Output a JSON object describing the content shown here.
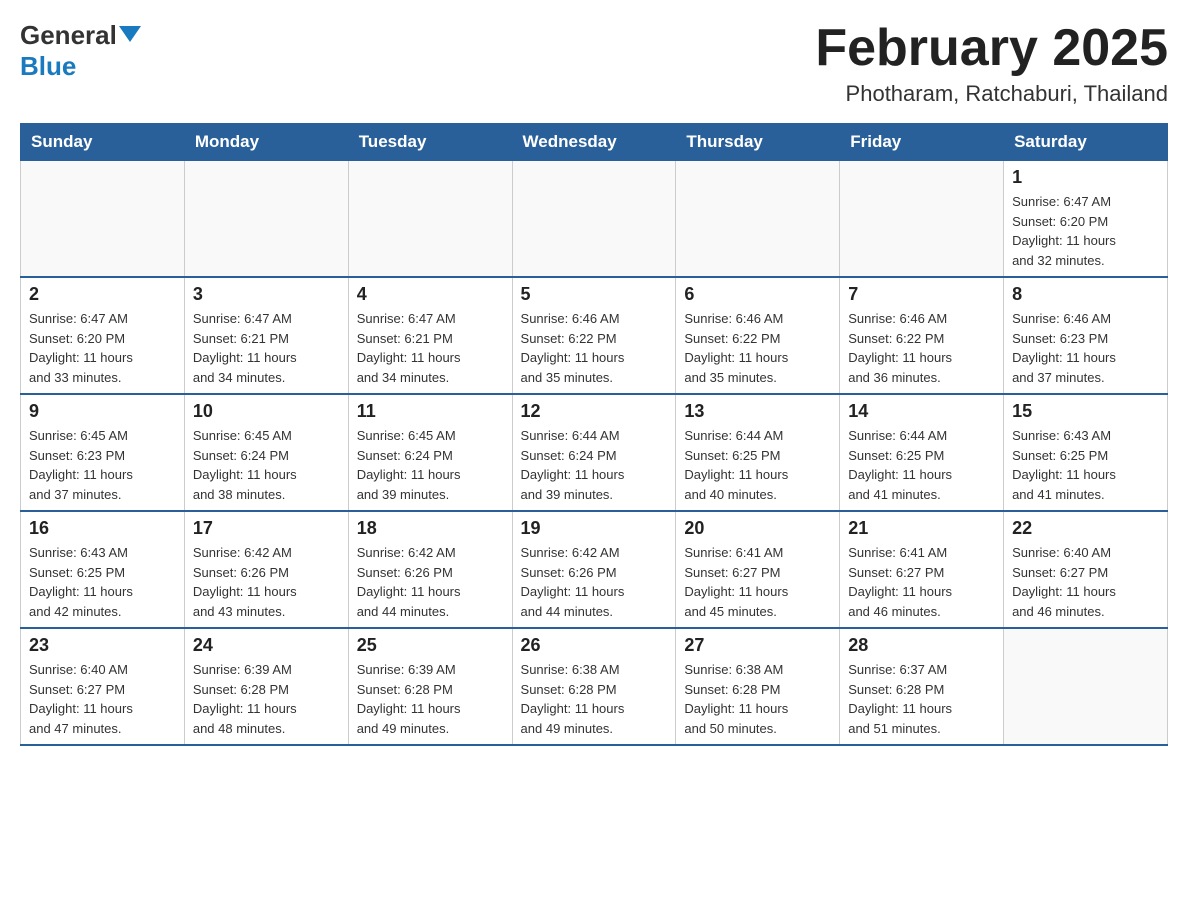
{
  "header": {
    "logo_general": "General",
    "logo_blue": "Blue",
    "title": "February 2025",
    "subtitle": "Photharam, Ratchaburi, Thailand"
  },
  "weekdays": [
    "Sunday",
    "Monday",
    "Tuesday",
    "Wednesday",
    "Thursday",
    "Friday",
    "Saturday"
  ],
  "weeks": [
    [
      {
        "day": "",
        "info": ""
      },
      {
        "day": "",
        "info": ""
      },
      {
        "day": "",
        "info": ""
      },
      {
        "day": "",
        "info": ""
      },
      {
        "day": "",
        "info": ""
      },
      {
        "day": "",
        "info": ""
      },
      {
        "day": "1",
        "info": "Sunrise: 6:47 AM\nSunset: 6:20 PM\nDaylight: 11 hours\nand 32 minutes."
      }
    ],
    [
      {
        "day": "2",
        "info": "Sunrise: 6:47 AM\nSunset: 6:20 PM\nDaylight: 11 hours\nand 33 minutes."
      },
      {
        "day": "3",
        "info": "Sunrise: 6:47 AM\nSunset: 6:21 PM\nDaylight: 11 hours\nand 34 minutes."
      },
      {
        "day": "4",
        "info": "Sunrise: 6:47 AM\nSunset: 6:21 PM\nDaylight: 11 hours\nand 34 minutes."
      },
      {
        "day": "5",
        "info": "Sunrise: 6:46 AM\nSunset: 6:22 PM\nDaylight: 11 hours\nand 35 minutes."
      },
      {
        "day": "6",
        "info": "Sunrise: 6:46 AM\nSunset: 6:22 PM\nDaylight: 11 hours\nand 35 minutes."
      },
      {
        "day": "7",
        "info": "Sunrise: 6:46 AM\nSunset: 6:22 PM\nDaylight: 11 hours\nand 36 minutes."
      },
      {
        "day": "8",
        "info": "Sunrise: 6:46 AM\nSunset: 6:23 PM\nDaylight: 11 hours\nand 37 minutes."
      }
    ],
    [
      {
        "day": "9",
        "info": "Sunrise: 6:45 AM\nSunset: 6:23 PM\nDaylight: 11 hours\nand 37 minutes."
      },
      {
        "day": "10",
        "info": "Sunrise: 6:45 AM\nSunset: 6:24 PM\nDaylight: 11 hours\nand 38 minutes."
      },
      {
        "day": "11",
        "info": "Sunrise: 6:45 AM\nSunset: 6:24 PM\nDaylight: 11 hours\nand 39 minutes."
      },
      {
        "day": "12",
        "info": "Sunrise: 6:44 AM\nSunset: 6:24 PM\nDaylight: 11 hours\nand 39 minutes."
      },
      {
        "day": "13",
        "info": "Sunrise: 6:44 AM\nSunset: 6:25 PM\nDaylight: 11 hours\nand 40 minutes."
      },
      {
        "day": "14",
        "info": "Sunrise: 6:44 AM\nSunset: 6:25 PM\nDaylight: 11 hours\nand 41 minutes."
      },
      {
        "day": "15",
        "info": "Sunrise: 6:43 AM\nSunset: 6:25 PM\nDaylight: 11 hours\nand 41 minutes."
      }
    ],
    [
      {
        "day": "16",
        "info": "Sunrise: 6:43 AM\nSunset: 6:25 PM\nDaylight: 11 hours\nand 42 minutes."
      },
      {
        "day": "17",
        "info": "Sunrise: 6:42 AM\nSunset: 6:26 PM\nDaylight: 11 hours\nand 43 minutes."
      },
      {
        "day": "18",
        "info": "Sunrise: 6:42 AM\nSunset: 6:26 PM\nDaylight: 11 hours\nand 44 minutes."
      },
      {
        "day": "19",
        "info": "Sunrise: 6:42 AM\nSunset: 6:26 PM\nDaylight: 11 hours\nand 44 minutes."
      },
      {
        "day": "20",
        "info": "Sunrise: 6:41 AM\nSunset: 6:27 PM\nDaylight: 11 hours\nand 45 minutes."
      },
      {
        "day": "21",
        "info": "Sunrise: 6:41 AM\nSunset: 6:27 PM\nDaylight: 11 hours\nand 46 minutes."
      },
      {
        "day": "22",
        "info": "Sunrise: 6:40 AM\nSunset: 6:27 PM\nDaylight: 11 hours\nand 46 minutes."
      }
    ],
    [
      {
        "day": "23",
        "info": "Sunrise: 6:40 AM\nSunset: 6:27 PM\nDaylight: 11 hours\nand 47 minutes."
      },
      {
        "day": "24",
        "info": "Sunrise: 6:39 AM\nSunset: 6:28 PM\nDaylight: 11 hours\nand 48 minutes."
      },
      {
        "day": "25",
        "info": "Sunrise: 6:39 AM\nSunset: 6:28 PM\nDaylight: 11 hours\nand 49 minutes."
      },
      {
        "day": "26",
        "info": "Sunrise: 6:38 AM\nSunset: 6:28 PM\nDaylight: 11 hours\nand 49 minutes."
      },
      {
        "day": "27",
        "info": "Sunrise: 6:38 AM\nSunset: 6:28 PM\nDaylight: 11 hours\nand 50 minutes."
      },
      {
        "day": "28",
        "info": "Sunrise: 6:37 AM\nSunset: 6:28 PM\nDaylight: 11 hours\nand 51 minutes."
      },
      {
        "day": "",
        "info": ""
      }
    ]
  ]
}
